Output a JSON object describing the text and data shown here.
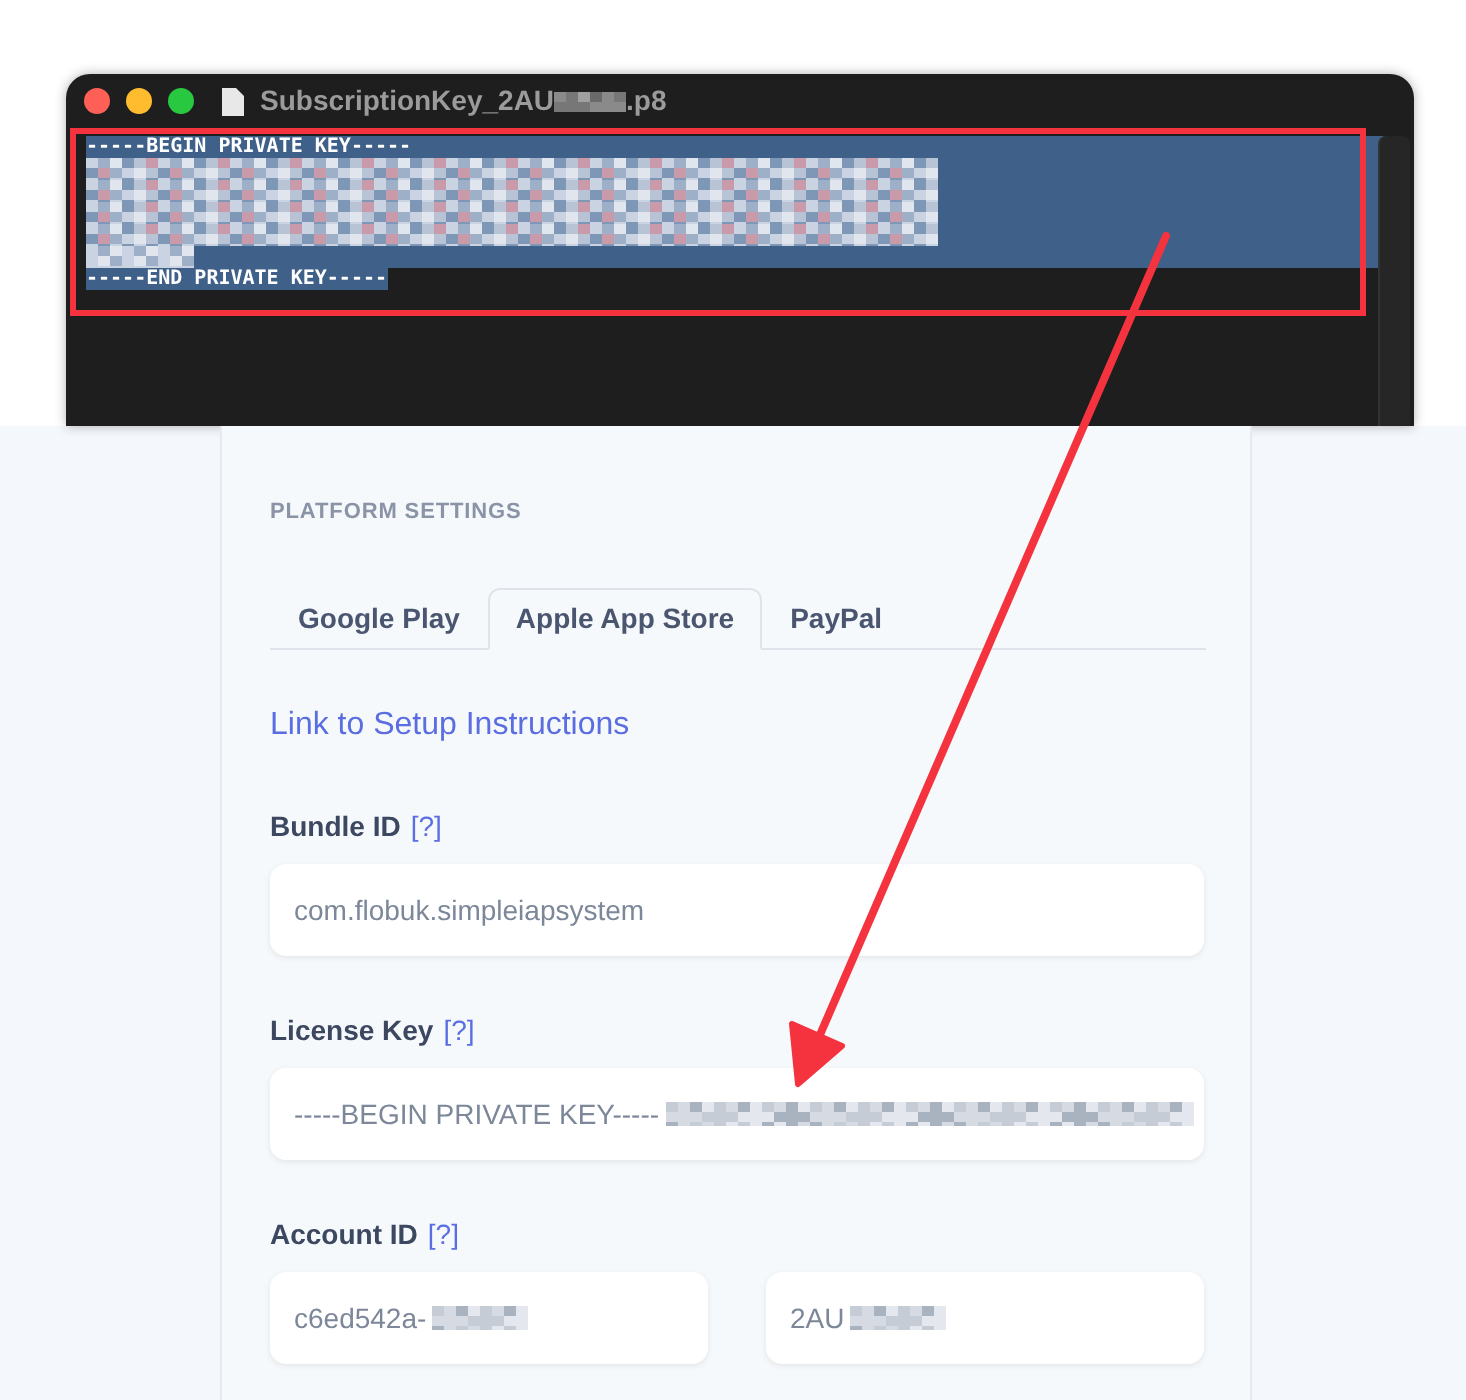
{
  "editor_window": {
    "title": "SubscriptionKey_2AU",
    "title_suffix": ".p8",
    "title_redacted": true,
    "lines": [
      {
        "kind": "text",
        "text": "-----BEGIN PRIVATE KEY-----"
      },
      {
        "kind": "redacted"
      },
      {
        "kind": "redacted"
      },
      {
        "kind": "redacted"
      },
      {
        "kind": "redacted"
      },
      {
        "kind": "redacted_short"
      },
      {
        "kind": "text",
        "text": "-----END PRIVATE KEY-----"
      }
    ]
  },
  "settings": {
    "heading": "PLATFORM SETTINGS",
    "tabs": [
      {
        "label": "Google Play",
        "selected": false
      },
      {
        "label": "Apple App Store",
        "selected": true
      },
      {
        "label": "PayPal",
        "selected": false
      }
    ],
    "link": "Link to Setup Instructions",
    "fields": [
      {
        "label": "Bundle ID",
        "help": "[?]",
        "inputs": [
          {
            "value": "com.flobuk.simpleiapsystem",
            "redacted": false
          }
        ]
      },
      {
        "label": "License Key",
        "help": "[?]",
        "inputs": [
          {
            "value": "-----BEGIN PRIVATE KEY-----",
            "redacted": true
          }
        ]
      },
      {
        "label": "Account ID",
        "help": "[?]",
        "inputs": [
          {
            "value": "c6ed542a-",
            "redacted": true
          },
          {
            "value": "2AU",
            "redacted": true
          }
        ]
      }
    ]
  }
}
